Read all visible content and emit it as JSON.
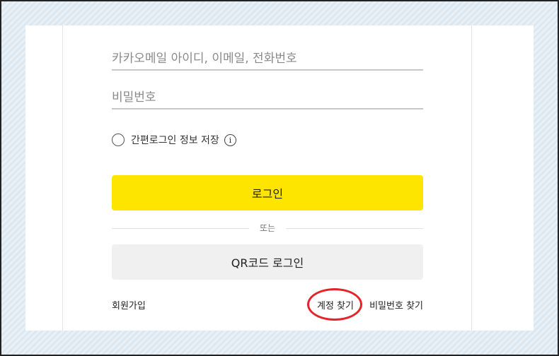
{
  "login_form": {
    "id_placeholder": "카카오메일 아이디, 이메일, 전화번호",
    "password_placeholder": "비밀번호",
    "remember_label": "간편로그인 정보 저장",
    "info_symbol": "i",
    "login_button": "로그인",
    "divider_text": "또는",
    "qr_button": "QR코드 로그인"
  },
  "footer_links": {
    "signup": "회원가입",
    "find_account": "계정 찾기",
    "find_password": "비밀번호 찾기"
  },
  "colors": {
    "login_button": "#fee500",
    "qr_button": "#f0f0f0",
    "highlight_circle": "#e3242b"
  }
}
